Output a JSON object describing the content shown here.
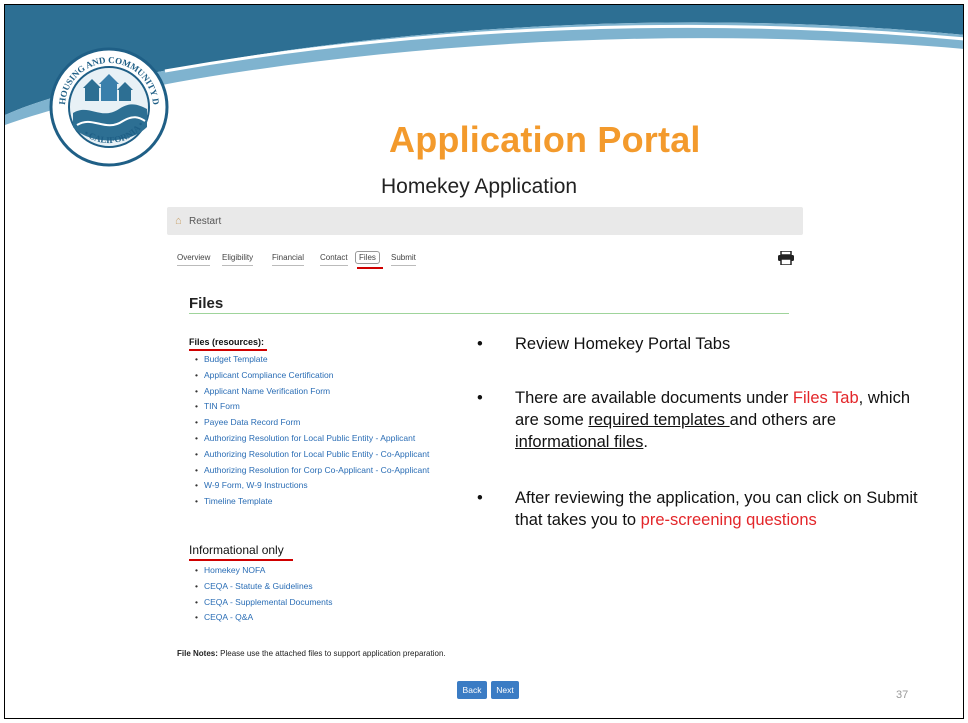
{
  "slide": {
    "title": "Application Portal",
    "subtitle": "Homekey Application",
    "page_number": "37"
  },
  "logo": {
    "ring_text_top": "HOUSING AND COMMUNITY DEVELOPMENT",
    "ring_text_bottom": "CALIFORNIA"
  },
  "portal": {
    "restart_label": "Restart",
    "tabs": [
      "Overview",
      "Eligibility",
      "Financial",
      "Contact",
      "Files",
      "Submit"
    ],
    "active_tab": "Files",
    "section_heading": "Files",
    "resources_label": "Files (resources):",
    "resource_files": [
      "Budget Template",
      "Applicant Compliance Certification",
      "Applicant Name Verification Form",
      "TIN Form",
      "Payee Data Record Form",
      "Authorizing Resolution for Local Public Entity - Applicant",
      "Authorizing Resolution for Local Public Entity - Co-Applicant",
      "Authorizing Resolution for Corp Co-Applicant - Co-Applicant",
      "W-9 Form, W-9 Instructions",
      "Timeline Template"
    ],
    "informational_label": "Informational only",
    "informational_files": [
      "Homekey NOFA",
      "CEQA - Statute & Guidelines",
      "CEQA - Supplemental Documents",
      "CEQA - Q&A"
    ],
    "file_notes_label": "File Notes:",
    "file_notes_text": "Please use the attached files to support application preparation.",
    "back_label": "Back",
    "next_label": "Next"
  },
  "bullets": {
    "b1": "Review Homekey Portal Tabs",
    "b2_part1": "There are available documents under ",
    "b2_red": "Files Tab",
    "b2_part2": ", which are some ",
    "b2_u1": "required templates ",
    "b2_part3": "and others are ",
    "b2_u2": "informational files",
    "b2_end": ".",
    "b3_part1": "After reviewing the application, you can click on Submit that takes you to ",
    "b3_red": "pre-screening questions"
  },
  "colors": {
    "title_orange": "#f39a2c",
    "accent_red": "#e3262a",
    "link_blue": "#2a6db5",
    "button_blue": "#3b7cc4",
    "swoosh_blue": "#2d6f93"
  }
}
